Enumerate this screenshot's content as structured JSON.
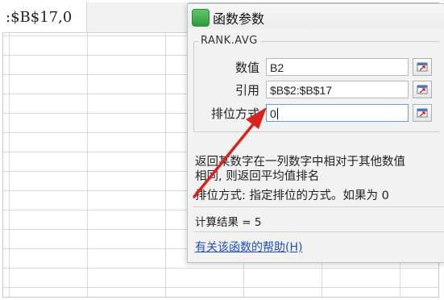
{
  "sheet": {
    "formula_fragment": ":$B$17,0"
  },
  "dialog": {
    "title": "函数参数",
    "function_name": "RANK.AVG",
    "args": [
      {
        "label": "数值",
        "value": "B2"
      },
      {
        "label": "引用",
        "value": "$B$2:$B$17"
      },
      {
        "label": "排位方式",
        "value": "0"
      }
    ],
    "description_line1": "返回某数字在一列数字中相对于其他数值",
    "description_line2": "相同, 则返回平均值排名",
    "arg_description": "排位方式: 指定排位的方式。如果为 0",
    "result": "计算结果 = 5",
    "help_link": "有关该函数的帮助(H)"
  },
  "colors": {
    "app_icon": "#3bb54a",
    "annotation_arrow": "#d9231f",
    "link": "#1f4fb6"
  },
  "icons": [
    "app-icon",
    "collapse-dialog-icon",
    "annotation-arrow"
  ]
}
